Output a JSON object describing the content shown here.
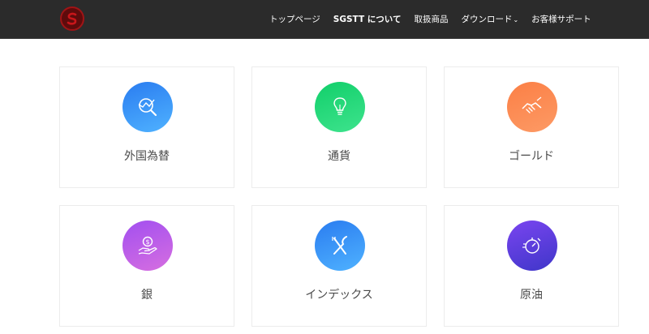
{
  "nav": {
    "items": [
      {
        "label": "トップページ"
      },
      {
        "label": "SGSTT について"
      },
      {
        "label": "取扱商品"
      },
      {
        "label": "ダウンロード"
      },
      {
        "label": "お客様サポート"
      }
    ],
    "dropdown_caret": "⌄"
  },
  "cards": [
    {
      "label": "外国為替",
      "icon": "magnifier-chart-icon",
      "color": "#2f8cf2"
    },
    {
      "label": "通貨",
      "icon": "lightbulb-icon",
      "color": "#1fd474"
    },
    {
      "label": "ゴールド",
      "icon": "handshake-icon",
      "color": "#fb8a52"
    },
    {
      "label": "銀",
      "icon": "hand-coin-icon",
      "color": "#b35ae8"
    },
    {
      "label": "インデックス",
      "icon": "fork-knife-icon",
      "color": "#2f8cf2"
    },
    {
      "label": "原油",
      "icon": "stopwatch-icon",
      "color": "#5b3fe0"
    }
  ],
  "colors": {
    "header_bg": "#2b2b2b",
    "logo_red": "#a01416",
    "text": "#4a4a4a"
  }
}
